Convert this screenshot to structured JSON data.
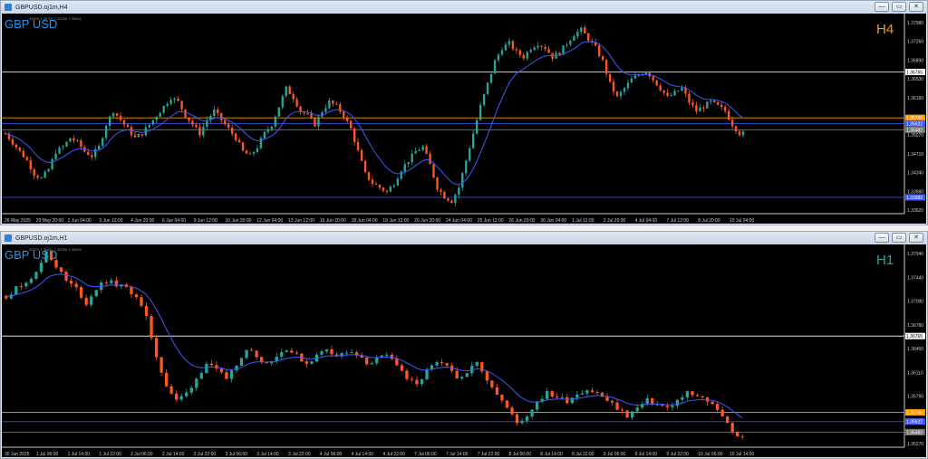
{
  "windows": [
    {
      "title": "GBPUSD.oj1m,H4",
      "symbol": "GBP USD",
      "timeframe": "H4",
      "ohlc_info": "35599 1.35705 1.35326 1.35482",
      "controls": {
        "minimize": "—",
        "restore": "▭",
        "close": "✕"
      },
      "colors": {
        "bull": "#26a69a",
        "bear": "#ff5722",
        "ma": "#3d5afe",
        "symbol": "#2196f3",
        "timeframe": "#ff9800"
      },
      "chart_data": {
        "type": "candlestick",
        "price_range": [
          1.3362,
          1.3798
        ],
        "price_ticks": [
          "1.37980",
          "1.37260",
          "1.36890",
          "1.36530",
          "1.36160",
          "1.35790",
          "1.35070",
          "1.34710",
          "1.34340",
          "1.33980",
          "1.33620"
        ],
        "time_labels": [
          "26 May 2025",
          "29 May 20:00",
          "2 Jun 04:00",
          "3 Jun 12:00",
          "4 Jun 20:00",
          "6 Jun 04:00",
          "9 Jun 12:00",
          "10 Jun 20:00",
          "12 Jun 04:00",
          "13 Jun 12:00",
          "16 Jun 20:00",
          "18 Jun 04:00",
          "19 Jun 12:00",
          "20 Jun 20:00",
          "24 Jun 04:00",
          "25 Jun 12:00",
          "26 Jun 20:00",
          "30 Jun 04:00",
          "1 Jul 12:00",
          "2 Jul 20:00",
          "4 Jul 04:00",
          "7 Jul 12:00",
          "8 Jul 20:00",
          "10 Jul 04:00"
        ],
        "levels": [
          {
            "price": 1.36765,
            "label": "1.36765",
            "color": "#ffffff"
          },
          {
            "price": 1.35746,
            "label": "1.35746",
            "color": "#ff9800"
          },
          {
            "price": 1.35622,
            "label": "1.35622",
            "color": "#3d5afe"
          },
          {
            "price": 1.35482,
            "label": "1.35482",
            "color": "#777777"
          },
          {
            "price": 1.33982,
            "label": "1.33982",
            "color": "#3d5afe"
          }
        ],
        "close_path": [
          1.354,
          1.352,
          1.35,
          1.348,
          1.345,
          1.344,
          1.346,
          1.35,
          1.351,
          1.353,
          1.352,
          1.35,
          1.349,
          1.351,
          1.356,
          1.359,
          1.357,
          1.355,
          1.353,
          1.354,
          1.356,
          1.358,
          1.36,
          1.362,
          1.361,
          1.358,
          1.356,
          1.354,
          1.357,
          1.359,
          1.357,
          1.355,
          1.353,
          1.35,
          1.349,
          1.351,
          1.354,
          1.356,
          1.36,
          1.364,
          1.362,
          1.359,
          1.358,
          1.356,
          1.359,
          1.361,
          1.36,
          1.358,
          1.355,
          1.35,
          1.345,
          1.343,
          1.342,
          1.341,
          1.343,
          1.346,
          1.348,
          1.35,
          1.351,
          1.347,
          1.342,
          1.34,
          1.339,
          1.342,
          1.348,
          1.354,
          1.36,
          1.365,
          1.37,
          1.373,
          1.374,
          1.372,
          1.371,
          1.373,
          1.374,
          1.373,
          1.371,
          1.372,
          1.374,
          1.376,
          1.377,
          1.375,
          1.373,
          1.37,
          1.365,
          1.362,
          1.364,
          1.366,
          1.367,
          1.368,
          1.366,
          1.364,
          1.362,
          1.363,
          1.364,
          1.361,
          1.359,
          1.36,
          1.361,
          1.36,
          1.359,
          1.356,
          1.354
        ]
      }
    },
    {
      "title": "GBPUSD.oj1m,H1",
      "symbol": "GBP USD",
      "timeframe": "H1",
      "ohlc_info": "35523 1.35551 1.35326 1.35482",
      "controls": {
        "minimize": "—",
        "restore": "▭",
        "close": "✕"
      },
      "colors": {
        "bull": "#26a69a",
        "bear": "#ff5722",
        "ma": "#3d5afe",
        "symbol": "#2196f3",
        "timeframe": "#26a69a"
      },
      "chart_data": {
        "type": "candlestick",
        "price_range": [
          1.3528,
          1.3794
        ],
        "price_ticks": [
          "1.37940",
          "1.37440",
          "1.37090",
          "1.36780",
          "1.36450",
          "1.36110",
          "1.35790",
          "1.35460",
          "1.35270"
        ],
        "time_labels": [
          "30 Jun 2025",
          "1 Jul 06:00",
          "1 Jul 14:00",
          "1 Jul 22:00",
          "2 Jul 06:00",
          "2 Jul 14:00",
          "2 Jul 22:00",
          "3 Jul 06:00",
          "3 Jul 14:00",
          "3 Jul 22:00",
          "4 Jul 06:00",
          "4 Jul 14:00",
          "4 Jul 22:00",
          "7 Jul 06:00",
          "7 Jul 14:00",
          "7 Jul 22:00",
          "8 Jul 06:00",
          "8 Jul 14:00",
          "8 Jul 22:00",
          "9 Jul 06:00",
          "9 Jul 14:00",
          "9 Jul 22:00",
          "10 Jul 06:00",
          "10 Jul 14:00"
        ],
        "levels": [
          {
            "price": 1.36765,
            "label": "1.36765",
            "color": "#ffffff"
          },
          {
            "price": 1.35746,
            "label": "1.35746",
            "color": "#ff9800"
          },
          {
            "price": 1.35622,
            "label": "1.35622",
            "color": "#3d5afe"
          },
          {
            "price": 1.35482,
            "label": "1.35482",
            "color": "#777777"
          }
        ],
        "close_path": [
          1.373,
          1.374,
          1.375,
          1.376,
          1.379,
          1.377,
          1.375,
          1.374,
          1.372,
          1.374,
          1.375,
          1.3745,
          1.374,
          1.373,
          1.37,
          1.365,
          1.361,
          1.359,
          1.36,
          1.362,
          1.364,
          1.363,
          1.362,
          1.364,
          1.366,
          1.365,
          1.364,
          1.365,
          1.366,
          1.365,
          1.364,
          1.365,
          1.366,
          1.365,
          1.3655,
          1.365,
          1.364,
          1.3645,
          1.365,
          1.364,
          1.362,
          1.361,
          1.363,
          1.364,
          1.3635,
          1.362,
          1.363,
          1.364,
          1.362,
          1.36,
          1.358,
          1.356,
          1.357,
          1.359,
          1.36,
          1.3595,
          1.359,
          1.36,
          1.3605,
          1.36,
          1.359,
          1.358,
          1.357,
          1.358,
          1.359,
          1.3585,
          1.358,
          1.359,
          1.36,
          1.3595,
          1.359,
          1.358,
          1.356,
          1.354
        ]
      }
    }
  ]
}
